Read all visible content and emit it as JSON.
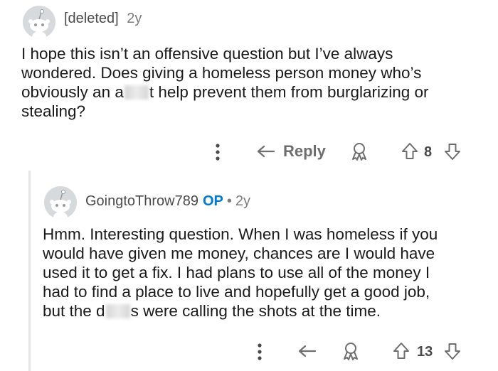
{
  "comments": [
    {
      "author": "[deleted]",
      "age": "2y",
      "body_part1": "I hope this isn’t an offensive question but I’ve always\nwondered. Does giving a homeless person money who’s\nobviously an a",
      "body_part2": "t help prevent them from burglarizing or\nstealing?",
      "reply_label": "Reply",
      "score": "8"
    },
    {
      "author": "GoingtoThrow789",
      "op_badge": "OP",
      "separator": "•",
      "age": "2y",
      "body_part1": "Hmm. Interesting question. When I was homeless if you\nwould have given me money, chances are I would have\nused it to get a fix. I had plans to use all of the money I\nhad to find a place to live and hopefully get a good job,\nbut the d",
      "body_part2": "s were calling the shots at the time.",
      "score": "13"
    }
  ],
  "colors": {
    "op": "#0079d3",
    "meta": "#7c7c7c",
    "icon": "#6e6e6e"
  }
}
